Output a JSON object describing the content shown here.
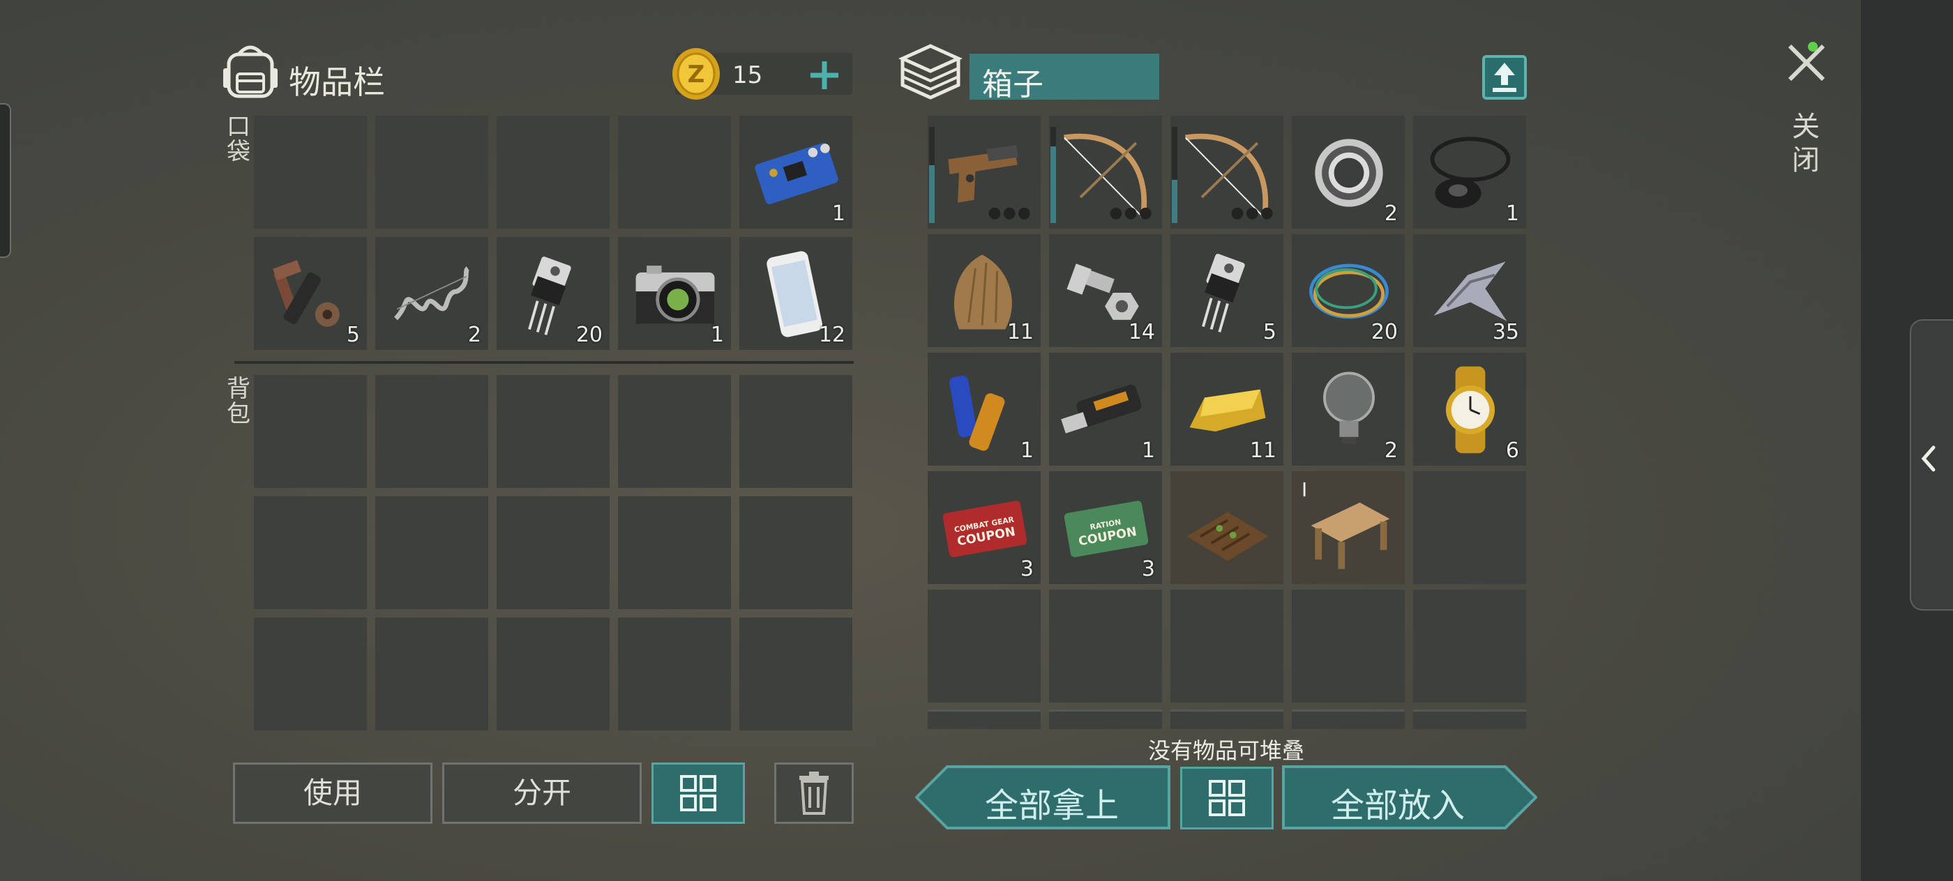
{
  "inventory": {
    "title": "物品栏",
    "coins": "15",
    "pocket_label": "口袋",
    "backpack_label": "背包",
    "pocket_items": [
      {
        "name": "empty"
      },
      {
        "name": "empty"
      },
      {
        "name": "empty"
      },
      {
        "name": "empty"
      },
      {
        "name": "circuit-board",
        "qty": "1"
      },
      {
        "name": "gun-parts",
        "qty": "5"
      },
      {
        "name": "spring",
        "qty": "2"
      },
      {
        "name": "transistor",
        "qty": "20"
      },
      {
        "name": "camera",
        "qty": "1"
      },
      {
        "name": "smartphone",
        "qty": "12"
      }
    ]
  },
  "chest": {
    "title": "箱子",
    "items": [
      {
        "name": "pistol",
        "durability": 0.6
      },
      {
        "name": "bow",
        "durability": 0.8
      },
      {
        "name": "bow",
        "durability": 0.45
      },
      {
        "name": "bearing",
        "qty": "2"
      },
      {
        "name": "rubber-seals",
        "qty": "1"
      },
      {
        "name": "fur",
        "qty": "11"
      },
      {
        "name": "bolt-and-nut",
        "qty": "14"
      },
      {
        "name": "transistor",
        "qty": "5"
      },
      {
        "name": "wires",
        "qty": "20"
      },
      {
        "name": "duct-tape",
        "qty": "35"
      },
      {
        "name": "batteries",
        "qty": "1"
      },
      {
        "name": "usb-drive",
        "qty": "1"
      },
      {
        "name": "gold-bar",
        "qty": "11"
      },
      {
        "name": "light-bulb",
        "qty": "2"
      },
      {
        "name": "gold-watch",
        "qty": "6"
      },
      {
        "name": "combat-gear-coupon",
        "qty": "3",
        "text": [
          "COMBAT GEAR",
          "COUPON"
        ]
      },
      {
        "name": "ration-coupon",
        "qty": "3",
        "text": [
          "RATION",
          "COUPON"
        ]
      },
      {
        "name": "garden-bed"
      },
      {
        "name": "workbench",
        "tier": "I"
      },
      {
        "name": "empty"
      }
    ]
  },
  "buttons": {
    "use": "使用",
    "split": "分开",
    "take_all": "全部拿上",
    "put_all": "全部放入"
  },
  "hint": "没有物品可堆叠",
  "close_label": "关闭",
  "colors": {
    "accent": "#3a7b7c",
    "slot": "#3b3e3b",
    "background": "#4a4a42"
  }
}
